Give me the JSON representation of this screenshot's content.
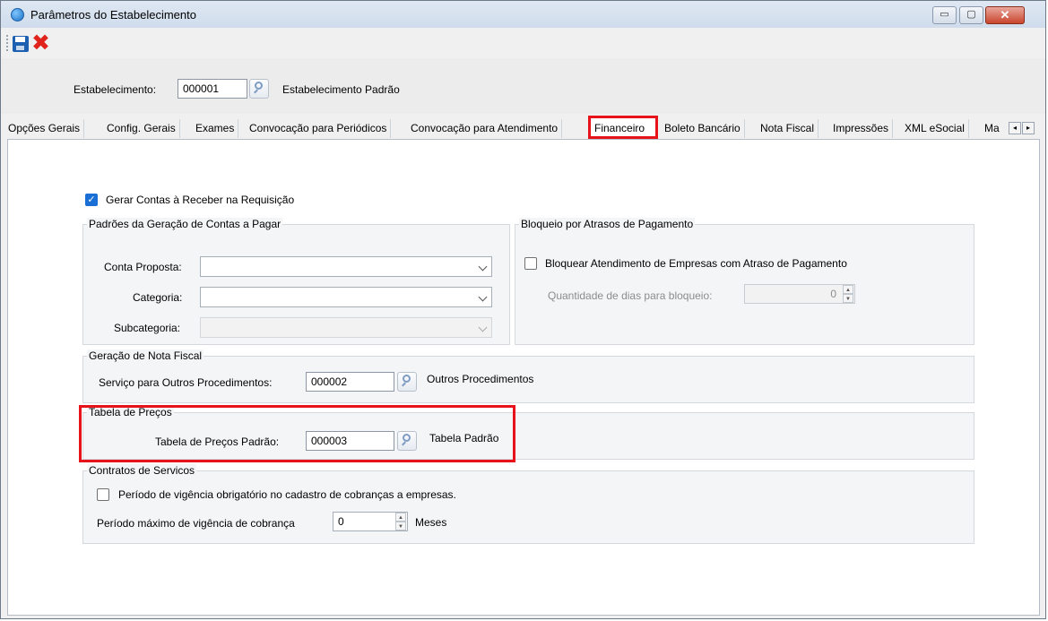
{
  "window": {
    "title": "Parâmetros do Estabelecimento",
    "app_icon": "app-logo-icon",
    "controls": {
      "minimize": "▭",
      "maximize": "▢",
      "close": "✕"
    }
  },
  "toolbar": {
    "save_icon": "save-icon",
    "cancel_icon": "cancel-icon",
    "cancel_glyph": "✖"
  },
  "header": {
    "estabelecimento_label": "Estabelecimento:",
    "estabelecimento_code": "000001",
    "estabelecimento_name": "Estabelecimento Padrão"
  },
  "tabs": [
    {
      "label": "Opções Gerais"
    },
    {
      "label": "Config. Gerais"
    },
    {
      "label": "Exames"
    },
    {
      "label": "Convocação para Periódicos"
    },
    {
      "label": "Convocação para Atendimento"
    },
    {
      "label": "Financeiro",
      "active": true
    },
    {
      "label": "Boleto Bancário"
    },
    {
      "label": "Nota Fiscal"
    },
    {
      "label": "Impressões"
    },
    {
      "label": "XML eSocial"
    },
    {
      "label": "Ma"
    }
  ],
  "tab_scroll": {
    "left": "◂",
    "right": "▸"
  },
  "financeiro": {
    "gerar_contas": {
      "label": "Gerar Contas à Receber na Requisição",
      "checked": true,
      "mark": "✓"
    },
    "padroes": {
      "title": "Padrões da Geração de Contas a Pagar",
      "conta_proposta_label": "Conta Proposta:",
      "conta_proposta_value": "",
      "categoria_label": "Categoria:",
      "categoria_value": "",
      "subcategoria_label": "Subcategoria:",
      "subcategoria_value": ""
    },
    "bloqueio": {
      "title": "Bloqueio por Atrasos de Pagamento",
      "checkbox_label": "Bloquear Atendimento de Empresas com Atraso de Pagamento",
      "checked": false,
      "dias_label": "Quantidade de dias para bloqueio:",
      "dias_value": "0"
    },
    "nota_fiscal": {
      "title": "Geração de Nota Fiscal",
      "servico_label": "Serviço para Outros Procedimentos:",
      "servico_code": "000002",
      "servico_name": "Outros Procedimentos"
    },
    "tabela_precos": {
      "title": "Tabela de Preços",
      "label": "Tabela de Preços Padrão:",
      "code": "000003",
      "name": "Tabela Padrão"
    },
    "contratos": {
      "title": "Contratos de Servicos",
      "vigencia_label": "Período de vigência obrigatório no cadastro de cobranças a empresas.",
      "vigencia_checked": false,
      "periodo_label": "Período máximo de vigência de cobrança",
      "periodo_value": "0",
      "periodo_unit": "Meses"
    }
  },
  "spin": {
    "up": "▲",
    "down": "▼"
  },
  "highlight_color": "#e8121a",
  "accent_color": "#1a6fd6"
}
